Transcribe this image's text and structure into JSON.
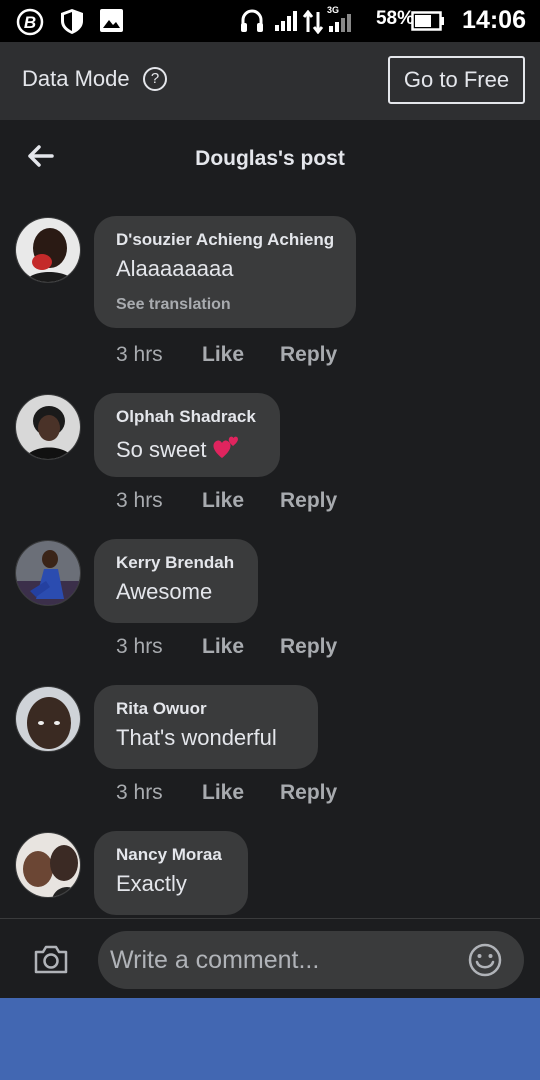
{
  "status_bar": {
    "battery_percent": "58%",
    "network_type": "3G",
    "time": "14:06"
  },
  "data_mode": {
    "label": "Data Mode",
    "help_symbol": "?",
    "go_free_label": "Go to Free"
  },
  "header": {
    "title": "Douglas's post"
  },
  "comments": [
    {
      "name": "D'souzier Achieng Achieng",
      "text": "Alaaaaaaaa",
      "translation_link": "See translation",
      "time": "3 hrs",
      "like": "Like",
      "reply": "Reply"
    },
    {
      "name": "Olphah Shadrack",
      "text": "So sweet",
      "emoji": "two-hearts",
      "time": "3 hrs",
      "like": "Like",
      "reply": "Reply"
    },
    {
      "name": "Kerry Brendah",
      "text": "Awesome",
      "time": "3 hrs",
      "like": "Like",
      "reply": "Reply"
    },
    {
      "name": "Rita Owuor",
      "text": "That's wonderful",
      "time": "3 hrs",
      "like": "Like",
      "reply": "Reply"
    },
    {
      "name": "Nancy Moraa",
      "text": "Exactly"
    }
  ],
  "composer": {
    "placeholder": "Write a comment..."
  },
  "colors": {
    "background": "#1c1d1f",
    "bubble": "#3a3b3c",
    "data_bar": "#2e2f31",
    "brand_blue": "#4267b2",
    "heart": "#e0245e"
  }
}
